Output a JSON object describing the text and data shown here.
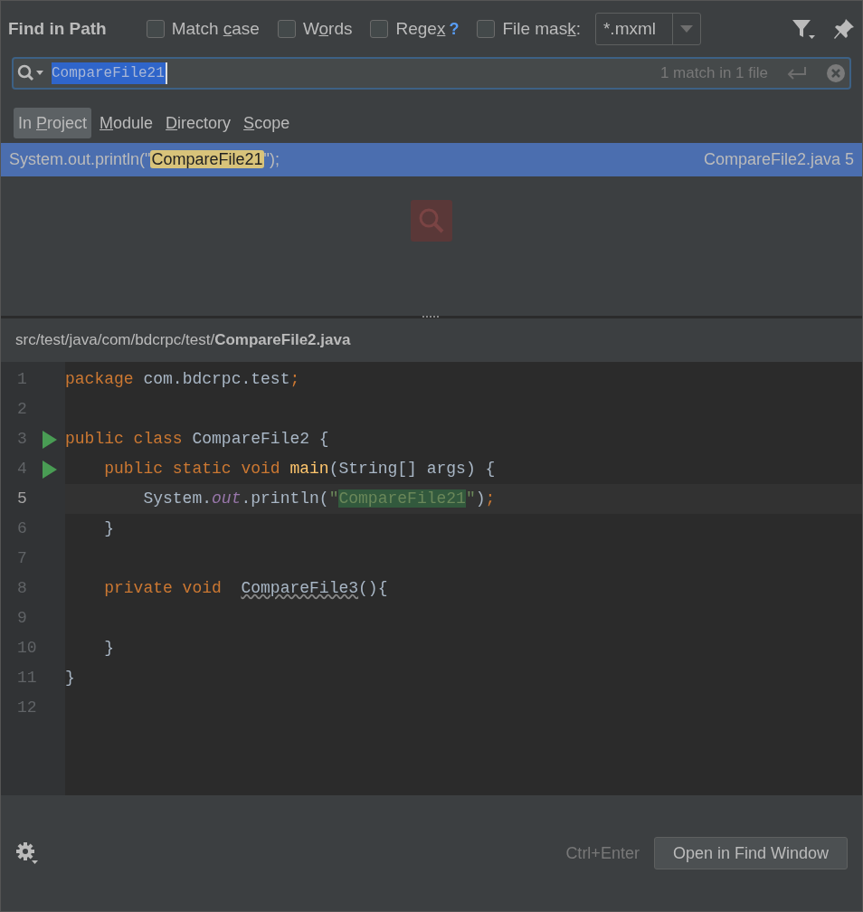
{
  "title": "Find in Path",
  "options": [
    {
      "label": {
        "before": "Match ",
        "key": "c",
        "after": "ase"
      },
      "checked": false
    },
    {
      "label": {
        "before": "W",
        "key": "o",
        "after": "rds"
      },
      "checked": false
    },
    {
      "label": {
        "before": "Rege",
        "key": "x"
      },
      "checked": false,
      "help": "?"
    },
    {
      "label": {
        "before": "File mas",
        "key": "k",
        "after": ":"
      },
      "checked": false
    }
  ],
  "file_mask": {
    "value": "*.mxml"
  },
  "search": {
    "value": "CompareFile21",
    "status": "1 match in 1 file"
  },
  "scopes": [
    {
      "label": {
        "before": "In ",
        "key": "P",
        "after": "roject"
      },
      "selected": true
    },
    {
      "label": {
        "key": "M",
        "after": "odule"
      },
      "selected": false
    },
    {
      "label": {
        "key": "D",
        "after": "irectory"
      },
      "selected": false
    },
    {
      "label": {
        "key": "S",
        "after": "cope"
      },
      "selected": false
    }
  ],
  "results": [
    {
      "before": "System.out.println(\"",
      "match": "CompareFile21",
      "after": "\");",
      "file": "CompareFile2.java 5",
      "selected": true
    }
  ],
  "preview": {
    "path": "src/test/java/com/bdcrpc/test/",
    "file": "CompareFile2.java"
  },
  "code": [
    {
      "number": "1",
      "current": false,
      "run": false,
      "tokens": [
        {
          "text": "package ",
          "kind": "keyword"
        },
        {
          "text": "com.bdcrpc.test",
          "kind": "plain"
        },
        {
          "text": ";",
          "kind": "keyword"
        }
      ]
    },
    {
      "number": "2",
      "current": false,
      "run": false
    },
    {
      "number": "3",
      "current": false,
      "run": true,
      "tokens": [
        {
          "text": "public class ",
          "kind": "keyword"
        },
        {
          "text": "CompareFile2 {",
          "kind": "plain"
        }
      ]
    },
    {
      "number": "4",
      "current": false,
      "run": true,
      "tokens": [
        {
          "text": "    public static void ",
          "kind": "keyword"
        },
        {
          "text": "main",
          "kind": "method"
        },
        {
          "text": "(String[] args) {",
          "kind": "plain"
        }
      ]
    },
    {
      "number": "5",
      "current": true,
      "run": false,
      "tokens": [
        {
          "text": "        System.",
          "kind": "plain"
        },
        {
          "text": "out",
          "kind": "field"
        },
        {
          "text": ".println(",
          "kind": "plain"
        },
        {
          "text": "\"",
          "kind": "string"
        },
        {
          "text": "CompareFile21",
          "kind": "match"
        },
        {
          "text": "\"",
          "kind": "string"
        },
        {
          "text": ")",
          "kind": "plain"
        },
        {
          "text": ";",
          "kind": "keyword"
        }
      ]
    },
    {
      "number": "6",
      "current": false,
      "run": false,
      "tokens": [
        {
          "text": "    }",
          "kind": "plain"
        }
      ]
    },
    {
      "number": "7",
      "current": false,
      "run": false
    },
    {
      "number": "8",
      "current": false,
      "run": false,
      "tokens": [
        {
          "text": "    private void  ",
          "kind": "keyword"
        },
        {
          "text": "CompareFile3",
          "kind": "unused"
        },
        {
          "text": "(){",
          "kind": "plain"
        }
      ]
    },
    {
      "number": "9",
      "current": false,
      "run": false
    },
    {
      "number": "10",
      "current": false,
      "run": false,
      "tokens": [
        {
          "text": "    }",
          "kind": "plain"
        }
      ]
    },
    {
      "number": "11",
      "current": false,
      "run": false,
      "tokens": [
        {
          "text": "}",
          "kind": "plain"
        }
      ]
    },
    {
      "number": "12",
      "current": false,
      "run": false
    }
  ],
  "footer": {
    "shortcut": "Ctrl+Enter",
    "button": "Open in Find Window"
  }
}
